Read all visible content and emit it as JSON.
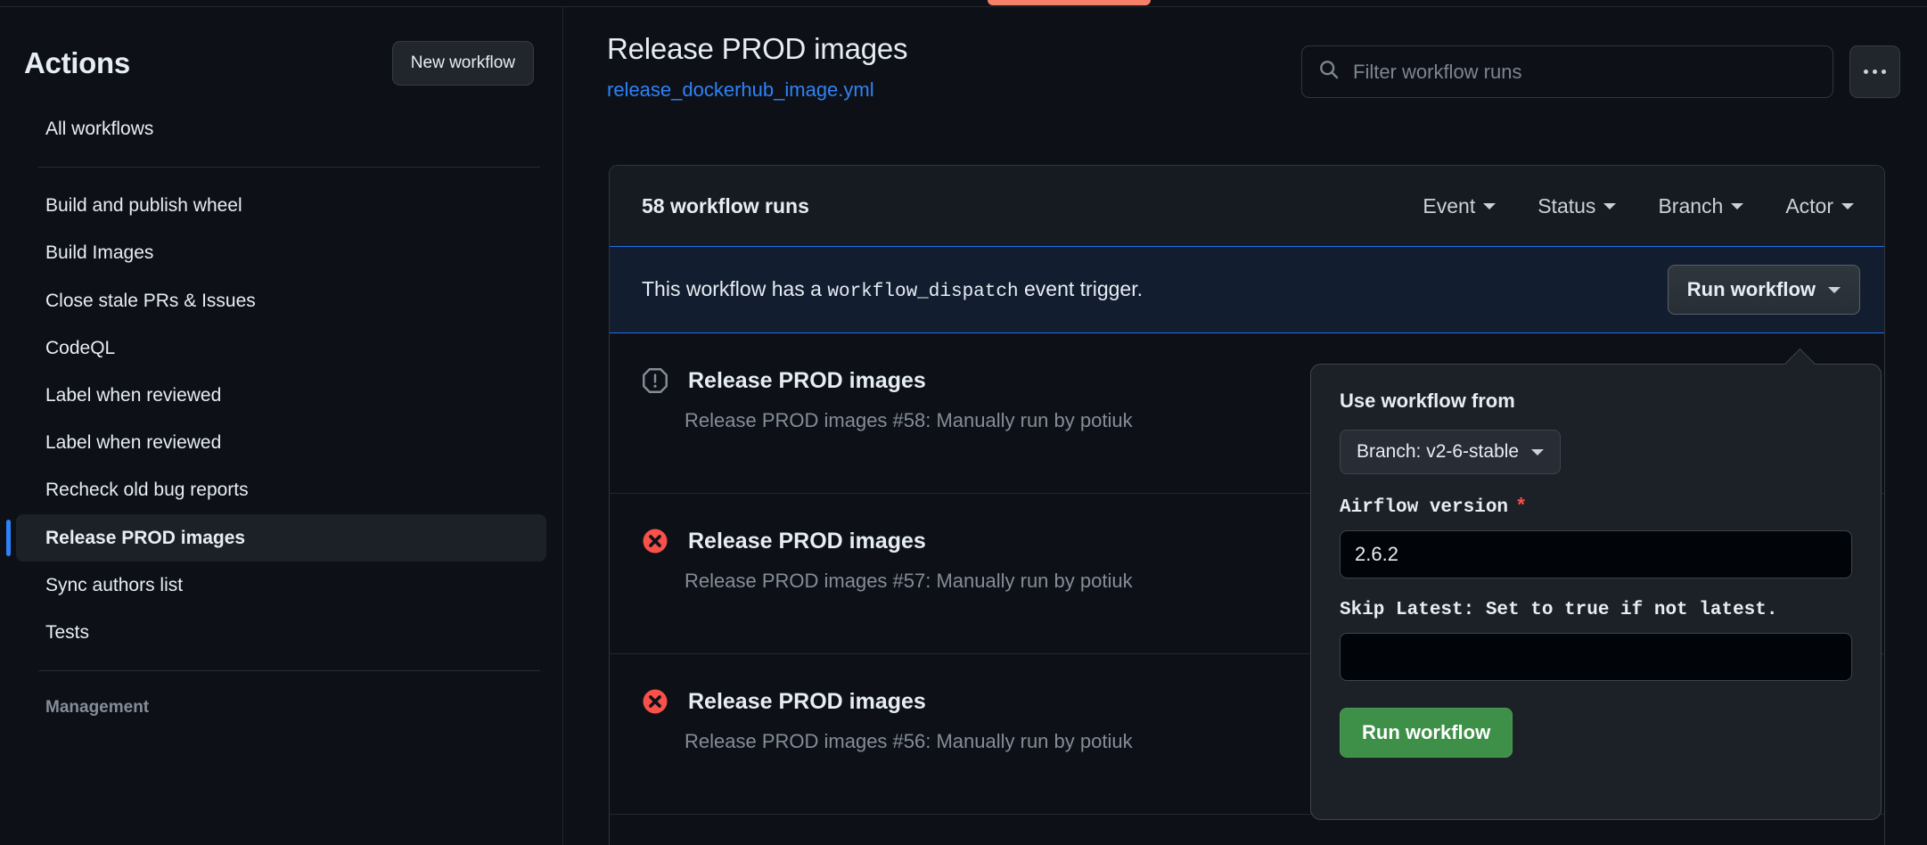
{
  "tab_indicator_color": "#f78166",
  "sidebar": {
    "title": "Actions",
    "new_workflow_label": "New workflow",
    "all_workflows_label": "All workflows",
    "items": [
      {
        "label": "Build and publish wheel",
        "selected": false
      },
      {
        "label": "Build Images",
        "selected": false
      },
      {
        "label": "Close stale PRs & Issues",
        "selected": false
      },
      {
        "label": "CodeQL",
        "selected": false
      },
      {
        "label": "Label when reviewed",
        "selected": false
      },
      {
        "label": "Label when reviewed",
        "selected": false
      },
      {
        "label": "Recheck old bug reports",
        "selected": false
      },
      {
        "label": "Release PROD images",
        "selected": true
      },
      {
        "label": "Sync authors list",
        "selected": false
      },
      {
        "label": "Tests",
        "selected": false
      }
    ],
    "management_label": "Management"
  },
  "header": {
    "title": "Release PROD images",
    "file_link": "release_dockerhub_image.yml",
    "search_placeholder": "Filter workflow runs",
    "search_value": "",
    "kebab_label": "..."
  },
  "runs": {
    "count_label": "58 workflow runs",
    "filters": [
      {
        "label": "Event"
      },
      {
        "label": "Status"
      },
      {
        "label": "Branch"
      },
      {
        "label": "Actor"
      }
    ],
    "banner": {
      "text_before": "This workflow has a",
      "code": "workflow_dispatch",
      "text_after": "event trigger.",
      "run_button_label": "Run workflow"
    },
    "rows": [
      {
        "status": "stale",
        "status_color": "#848d97",
        "title": "Release PROD images",
        "subtitle": "Release PROD images #58: Manually run by potiuk"
      },
      {
        "status": "failure",
        "status_color": "#f85149",
        "title": "Release PROD images",
        "subtitle": "Release PROD images #57: Manually run by potiuk"
      },
      {
        "status": "failure",
        "status_color": "#f85149",
        "title": "Release PROD images",
        "subtitle": "Release PROD images #56: Manually run by potiuk"
      }
    ]
  },
  "workflow_panel": {
    "use_workflow_from_label": "Use workflow from",
    "branch_value": "Branch: v2-6-stable",
    "airflow_version_label": "Airflow version",
    "required_marker": "*",
    "airflow_version_value": "2.6.2",
    "skip_latest_label": "Skip Latest: Set to true if not latest.",
    "skip_latest_value": "",
    "submit_label": "Run workflow",
    "submit_color": "#3e8f47"
  }
}
